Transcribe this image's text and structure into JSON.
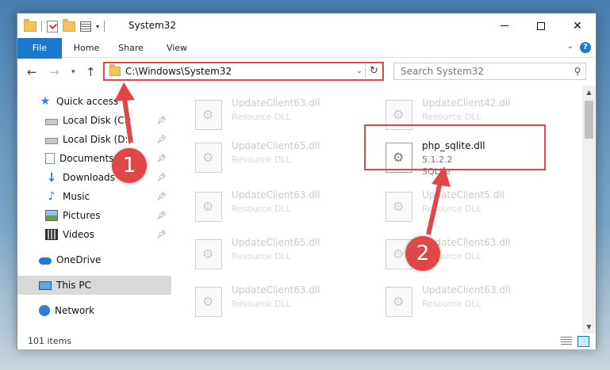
{
  "window": {
    "title": "System32"
  },
  "ribbon": {
    "tabs": [
      "File",
      "Home",
      "Share",
      "View"
    ],
    "help": "?"
  },
  "nav": {
    "address": "C:\\Windows\\System32",
    "search_placeholder": "Search System32"
  },
  "sidebar": {
    "items": [
      {
        "label": "Quick access",
        "icon": "star-icon",
        "pinned": false
      },
      {
        "label": "Local Disk (C:)",
        "icon": "drive-icon",
        "pinned": true
      },
      {
        "label": "Local Disk (D:)",
        "icon": "drive-icon",
        "pinned": true
      },
      {
        "label": "Documents",
        "icon": "documents-icon",
        "pinned": true
      },
      {
        "label": "Downloads",
        "icon": "download-icon",
        "pinned": true
      },
      {
        "label": "Music",
        "icon": "music-icon",
        "pinned": true
      },
      {
        "label": "Pictures",
        "icon": "pictures-icon",
        "pinned": true
      },
      {
        "label": "Videos",
        "icon": "videos-icon",
        "pinned": true
      },
      {
        "label": "OneDrive",
        "icon": "cloud-icon",
        "pinned": false
      },
      {
        "label": "This PC",
        "icon": "computer-icon",
        "pinned": false
      },
      {
        "label": "Network",
        "icon": "network-icon",
        "pinned": false
      }
    ]
  },
  "files": [
    {
      "name": "UpdateClient63.dll",
      "type": "Resource DLL",
      "extra": ""
    },
    {
      "name": "UpdateClient42.dll",
      "type": "Resource DLL",
      "extra": ""
    },
    {
      "name": "UpdateClient65.dll",
      "type": "Resource DLL",
      "extra": ""
    },
    {
      "name": "php_sqlite.dll",
      "type": "5.1.2.2",
      "extra": "SQLite"
    },
    {
      "name": "UpdateClient63.dll",
      "type": "Resource DLL",
      "extra": ""
    },
    {
      "name": "UpdateClient5.dll",
      "type": "Resource DLL",
      "extra": ""
    },
    {
      "name": "UpdateClient65.dll",
      "type": "Resource DLL",
      "extra": ""
    },
    {
      "name": "UpdateClient63.dll",
      "type": "Resource DLL",
      "extra": ""
    },
    {
      "name": "UpdateClient63.dll",
      "type": "Resource DLL",
      "extra": ""
    },
    {
      "name": "UpdateClient63.dll",
      "type": "Resource DLL",
      "extra": ""
    }
  ],
  "status": {
    "count": "101 items"
  },
  "callouts": [
    "1",
    "2"
  ],
  "colors": {
    "accent": "#1979ca",
    "highlight": "#e04848"
  }
}
